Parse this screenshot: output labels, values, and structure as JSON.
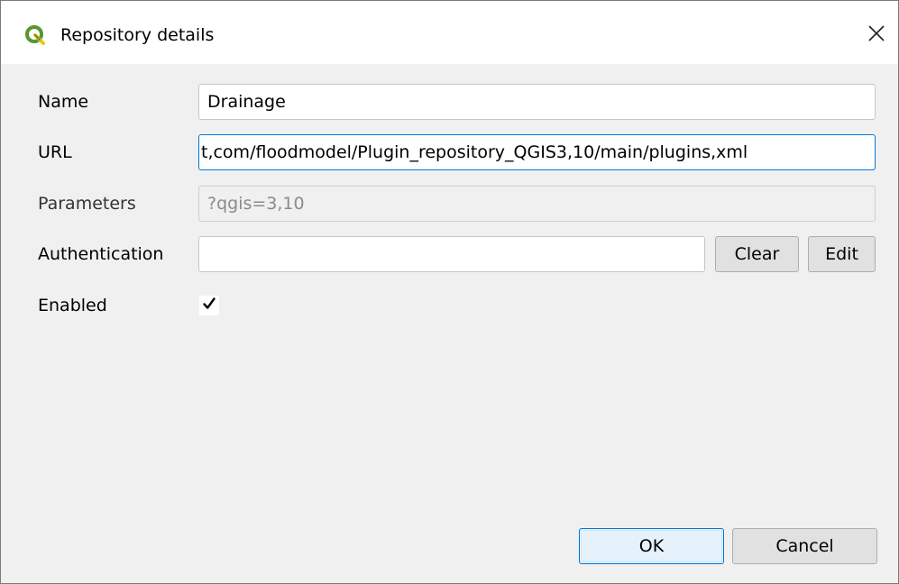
{
  "window": {
    "title": "Repository details",
    "icon": "qgis-logo-icon",
    "close_glyph": "✕"
  },
  "form": {
    "name": {
      "label": "Name",
      "value": "Drainage"
    },
    "url": {
      "label": "URL",
      "value": "t,com/floodmodel/Plugin_repository_QGIS3,10/main/plugins,xml"
    },
    "parameters": {
      "label": "Parameters",
      "value": "?qgis=3,10"
    },
    "authentication": {
      "label": "Authentication",
      "value": "",
      "clear_label": "Clear",
      "edit_label": "Edit"
    },
    "enabled": {
      "label": "Enabled",
      "checked": true,
      "check_glyph": "✔"
    }
  },
  "footer": {
    "ok_label": "OK",
    "cancel_label": "Cancel"
  },
  "colors": {
    "accent": "#0078d7",
    "qgis_green": "#589632",
    "qgis_yellow": "#f0c419",
    "dialog_bg": "#f0f0f0"
  }
}
